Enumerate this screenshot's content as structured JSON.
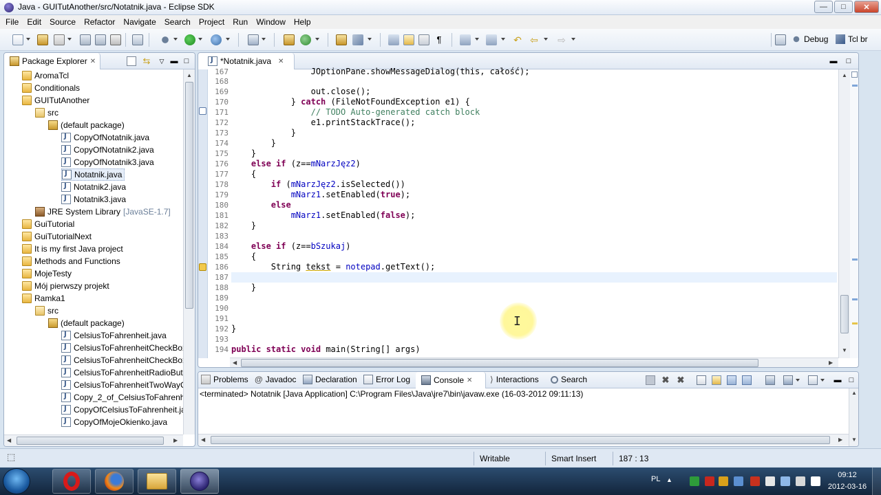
{
  "window": {
    "title": "Java - GUITutAnother/src/Notatnik.java - Eclipse SDK",
    "controls": {
      "minimize": "—",
      "maximize": "□",
      "close": "✕"
    }
  },
  "menu": [
    "File",
    "Edit",
    "Source",
    "Refactor",
    "Navigate",
    "Search",
    "Project",
    "Run",
    "Window",
    "Help"
  ],
  "perspectives": {
    "debug": "Debug",
    "tcl": "Tcl br"
  },
  "package_explorer": {
    "title": "Package Explorer",
    "items": [
      {
        "label": "AromaTcl",
        "indent": 0,
        "icon": "project-icon"
      },
      {
        "label": "Conditionals",
        "indent": 0,
        "icon": "project-icon"
      },
      {
        "label": "GUITutAnother",
        "indent": 0,
        "icon": "project-icon"
      },
      {
        "label": "src",
        "indent": 1,
        "icon": "source-folder-icon"
      },
      {
        "label": "(default package)",
        "indent": 2,
        "icon": "package-icon"
      },
      {
        "label": "CopyOfNotatnik.java",
        "indent": 3,
        "icon": "java-file-icon"
      },
      {
        "label": "CopyOfNotatnik2.java",
        "indent": 3,
        "icon": "java-file-icon"
      },
      {
        "label": "CopyOfNotatnik3.java",
        "indent": 3,
        "icon": "java-file-icon"
      },
      {
        "label": "Notatnik.java",
        "indent": 3,
        "icon": "java-file-icon",
        "selected": true
      },
      {
        "label": "Notatnik2.java",
        "indent": 3,
        "icon": "java-file-icon"
      },
      {
        "label": "Notatnik3.java",
        "indent": 3,
        "icon": "java-file-icon"
      },
      {
        "label": "JRE System Library",
        "suffix": "[JavaSE-1.7]",
        "indent": 1,
        "icon": "library-icon"
      },
      {
        "label": "GuiTutorial",
        "indent": 0,
        "icon": "project-icon"
      },
      {
        "label": "GuiTutorialNext",
        "indent": 0,
        "icon": "project-icon"
      },
      {
        "label": "It is my first Java project",
        "indent": 0,
        "icon": "project-icon"
      },
      {
        "label": "Methods and Functions",
        "indent": 0,
        "icon": "project-icon"
      },
      {
        "label": "MojeTesty",
        "indent": 0,
        "icon": "project-icon"
      },
      {
        "label": "Mój pierwszy projekt",
        "indent": 0,
        "icon": "project-icon"
      },
      {
        "label": "Ramka1",
        "indent": 0,
        "icon": "project-icon"
      },
      {
        "label": "src",
        "indent": 1,
        "icon": "source-folder-icon"
      },
      {
        "label": "(default package)",
        "indent": 2,
        "icon": "package-icon"
      },
      {
        "label": "CelsiusToFahrenheit.java",
        "indent": 3,
        "icon": "java-file-icon"
      },
      {
        "label": "CelsiusToFahrenheitCheckBox",
        "indent": 3,
        "icon": "java-file-icon"
      },
      {
        "label": "CelsiusToFahrenheitCheckBox",
        "indent": 3,
        "icon": "java-file-icon"
      },
      {
        "label": "CelsiusToFahrenheitRadioBut",
        "indent": 3,
        "icon": "java-file-icon"
      },
      {
        "label": "CelsiusToFahrenheitTwoWayC",
        "indent": 3,
        "icon": "java-file-icon"
      },
      {
        "label": "Copy_2_of_CelsiusToFahrenhe",
        "indent": 3,
        "icon": "java-file-icon"
      },
      {
        "label": "CopyOfCelsiusToFahrenheit.ja",
        "indent": 3,
        "icon": "java-file-icon"
      },
      {
        "label": "CopyOfMojeOkienko.java",
        "indent": 3,
        "icon": "java-file-icon"
      }
    ]
  },
  "editor": {
    "tab": "*Notatnik.java",
    "line_numbers": [
      "168",
      "169",
      "170",
      "171",
      "172",
      "173",
      "174",
      "175",
      "176",
      "177",
      "178",
      "179",
      "180",
      "181",
      "182",
      "183",
      "184",
      "185",
      "186",
      "187",
      "188",
      "189",
      "190",
      "191",
      "192",
      "193",
      "194"
    ],
    "partial_line_number": "167",
    "partial_line_text": "JOptionPane.showMessageDialog(this, całość);",
    "current_line": "187"
  },
  "bottom_tabs": [
    "Problems",
    "Javadoc",
    "Declaration",
    "Error Log",
    "Console",
    "Interactions",
    "Search"
  ],
  "console": {
    "status": "<terminated> Notatnik [Java Application] C:\\Program Files\\Java\\jre7\\bin\\javaw.exe (16-03-2012 09:11:13)"
  },
  "status_bar": {
    "mode": "Writable",
    "insert": "Smart Insert",
    "position": "187 : 13"
  },
  "taskbar": {
    "lang": "PL",
    "time": "09:12",
    "date": "2012-03-16",
    "apps": [
      "opera-icon",
      "firefox-icon",
      "explorer-folder-icon",
      "eclipse-icon"
    ]
  },
  "colors": {
    "keyword": "#7f0055",
    "comment": "#3f7f5f",
    "field": "#0000c0",
    "current_line": "#e8f2fe"
  }
}
